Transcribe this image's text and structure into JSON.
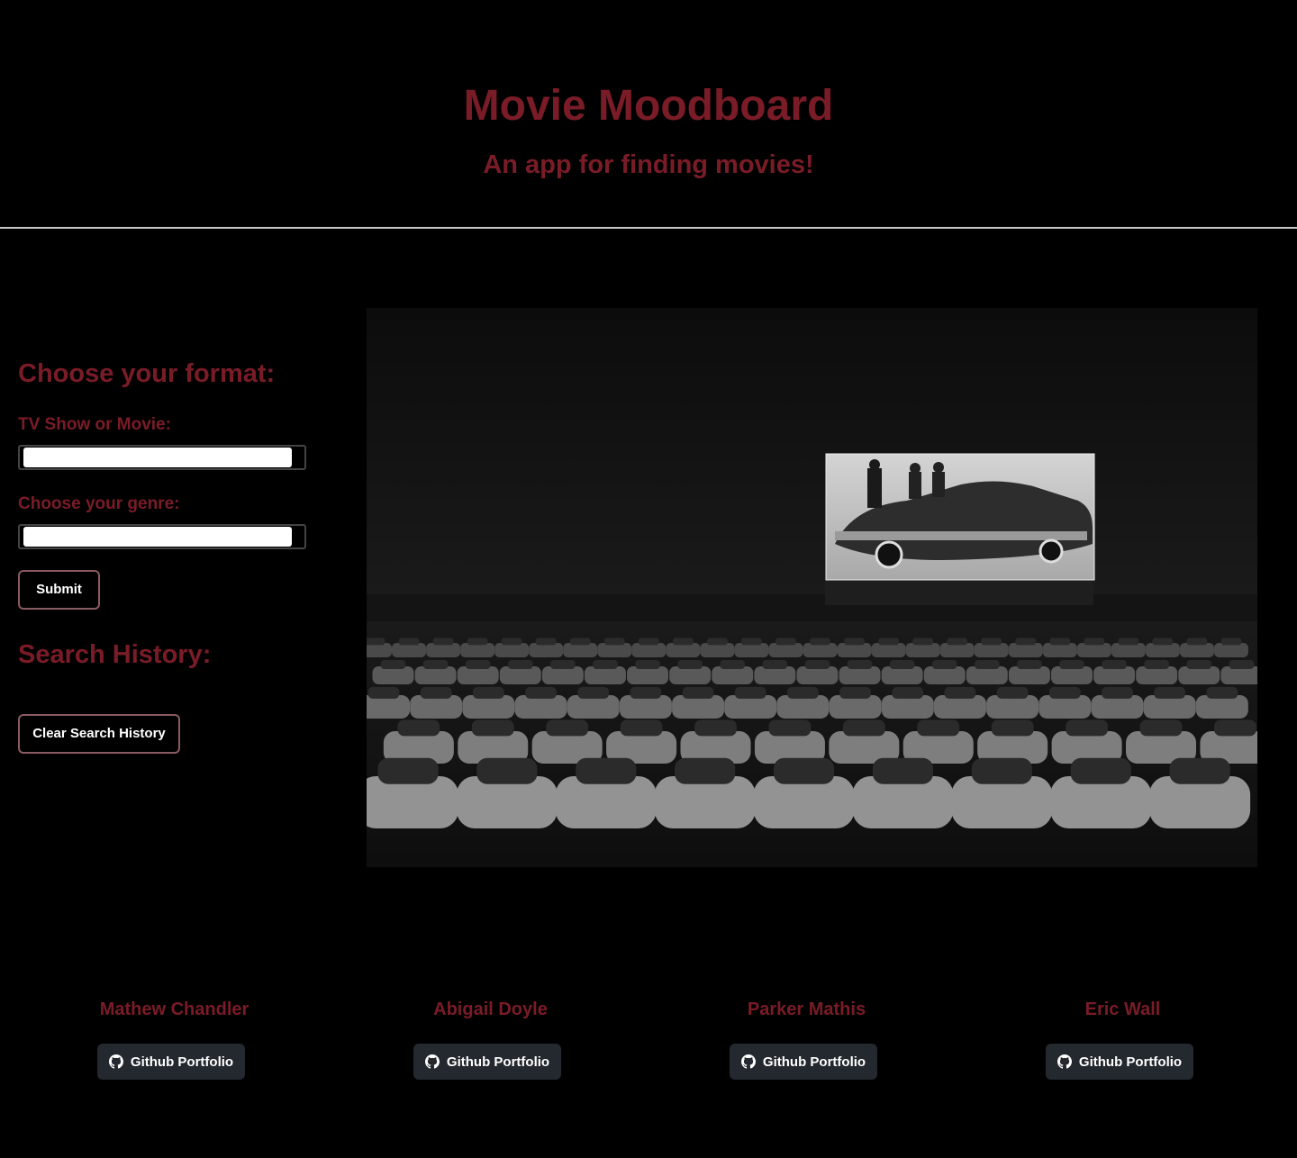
{
  "header": {
    "title": "Movie Moodboard",
    "subtitle": "An app for finding movies!"
  },
  "sidebar": {
    "format_heading": "Choose your format:",
    "format_label": "TV Show or Movie:",
    "format_value": "",
    "genre_label": "Choose your genre:",
    "genre_value": "",
    "submit_label": "Submit",
    "history_heading": "Search History:",
    "clear_label": "Clear Search History"
  },
  "hero": {
    "icon": "drive-in-theater-photo"
  },
  "team": [
    {
      "name": "Mathew Chandler",
      "link_label": "Github Portfolio",
      "icon": "github-icon"
    },
    {
      "name": "Abigail Doyle",
      "link_label": "Github Portfolio",
      "icon": "github-icon"
    },
    {
      "name": "Parker Mathis",
      "link_label": "Github Portfolio",
      "icon": "github-icon"
    },
    {
      "name": "Eric Wall",
      "link_label": "Github Portfolio",
      "icon": "github-icon"
    }
  ],
  "colors": {
    "accent": "#7a1c27",
    "background": "#000000",
    "button_dark": "#24292f"
  }
}
